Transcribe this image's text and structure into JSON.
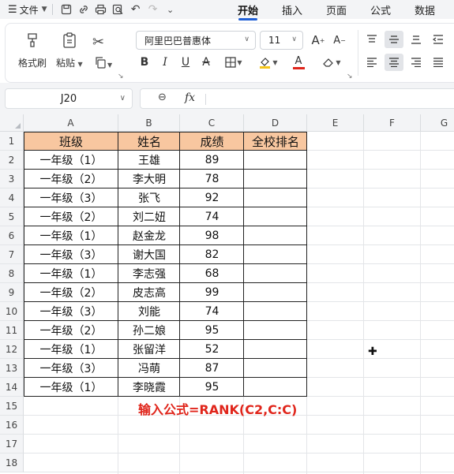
{
  "menu": {
    "file_label": "文件",
    "tabs": [
      {
        "label": "开始",
        "active": true
      },
      {
        "label": "插入",
        "active": false
      },
      {
        "label": "页面",
        "active": false
      },
      {
        "label": "公式",
        "active": false
      },
      {
        "label": "数据",
        "active": false
      }
    ]
  },
  "ribbon": {
    "format_painter": "格式刷",
    "paste": "粘贴",
    "font_name": "阿里巴巴普惠体",
    "font_size": "11"
  },
  "formula_bar": {
    "name_box": "J20",
    "fx": "fx",
    "formula": ""
  },
  "grid": {
    "columns": [
      "A",
      "B",
      "C",
      "D",
      "E",
      "F",
      "G"
    ],
    "rows": [
      "1",
      "2",
      "3",
      "4",
      "5",
      "6",
      "7",
      "8",
      "9",
      "10",
      "11",
      "12",
      "13",
      "14",
      "15",
      "16",
      "17",
      "18"
    ],
    "headers": [
      "班级",
      "姓名",
      "成绩",
      "全校排名"
    ],
    "data": [
      [
        "一年级（1）",
        "王雄",
        "89",
        ""
      ],
      [
        "一年级（2）",
        "李大明",
        "78",
        ""
      ],
      [
        "一年级（3）",
        "张飞",
        "92",
        ""
      ],
      [
        "一年级（2）",
        "刘二妞",
        "74",
        ""
      ],
      [
        "一年级（1）",
        "赵金龙",
        "98",
        ""
      ],
      [
        "一年级（3）",
        "谢大国",
        "82",
        ""
      ],
      [
        "一年级（1）",
        "李志强",
        "68",
        ""
      ],
      [
        "一年级（2）",
        "皮志高",
        "99",
        ""
      ],
      [
        "一年级（3）",
        "刘能",
        "74",
        ""
      ],
      [
        "一年级（2）",
        "孙二娘",
        "95",
        ""
      ],
      [
        "一年级（1）",
        "张留洋",
        "52",
        ""
      ],
      [
        "一年级（3）",
        "冯萌",
        "87",
        ""
      ],
      [
        "一年级（1）",
        "李晓霞",
        "95",
        ""
      ]
    ],
    "note": "输入公式=RANK(C2,C:C)"
  },
  "colors": {
    "header_fill": "#f8c7a0",
    "note_text": "#e0251b",
    "active_tab_underline": "#1f5fd6"
  }
}
